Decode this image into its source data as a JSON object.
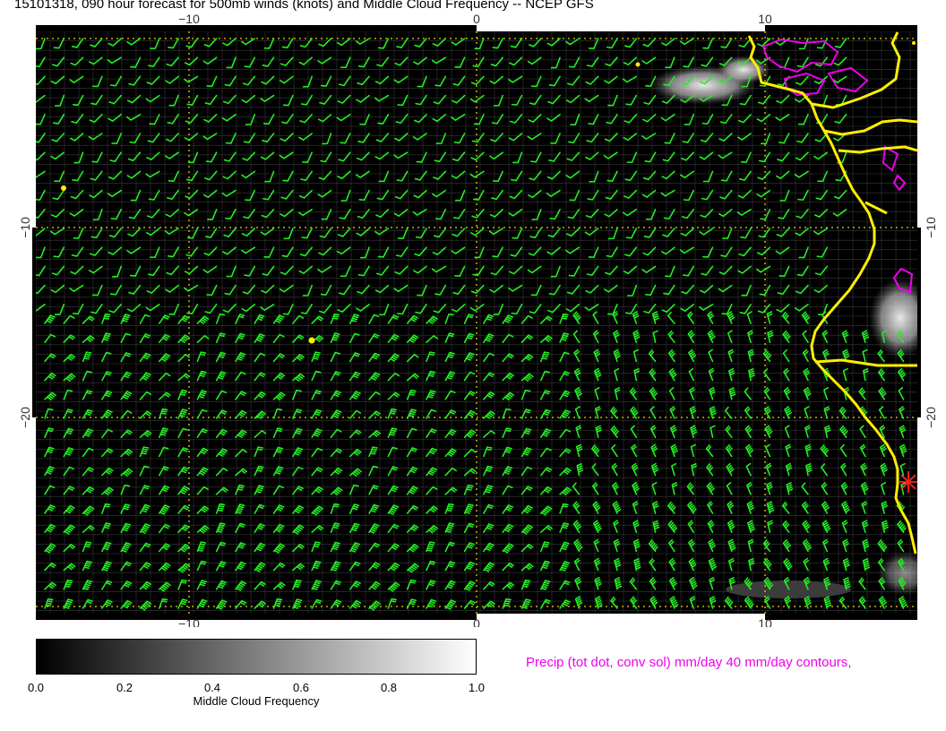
{
  "title": "15101318, 090 hour forecast for 500mb winds (knots) and Middle Cloud Frequency -- NCEP GFS",
  "axes": {
    "lon_ticks": [
      "−10",
      "0",
      "10"
    ],
    "lat_ticks": [
      "−10",
      "−20"
    ]
  },
  "colors": {
    "barb": "#22ee22",
    "coast": "#ffee00",
    "grid": "#e6d200",
    "precip": "#ee00ee",
    "marker": "#ff2222",
    "background": "#000000"
  },
  "colorbar": {
    "ticks": [
      "0.0",
      "0.2",
      "0.4",
      "0.6",
      "0.8",
      "1.0"
    ],
    "label": "Middle Cloud Frequency"
  },
  "precip_note": "Precip (tot dot, conv sol) mm/day 40 mm/day contours,"
}
